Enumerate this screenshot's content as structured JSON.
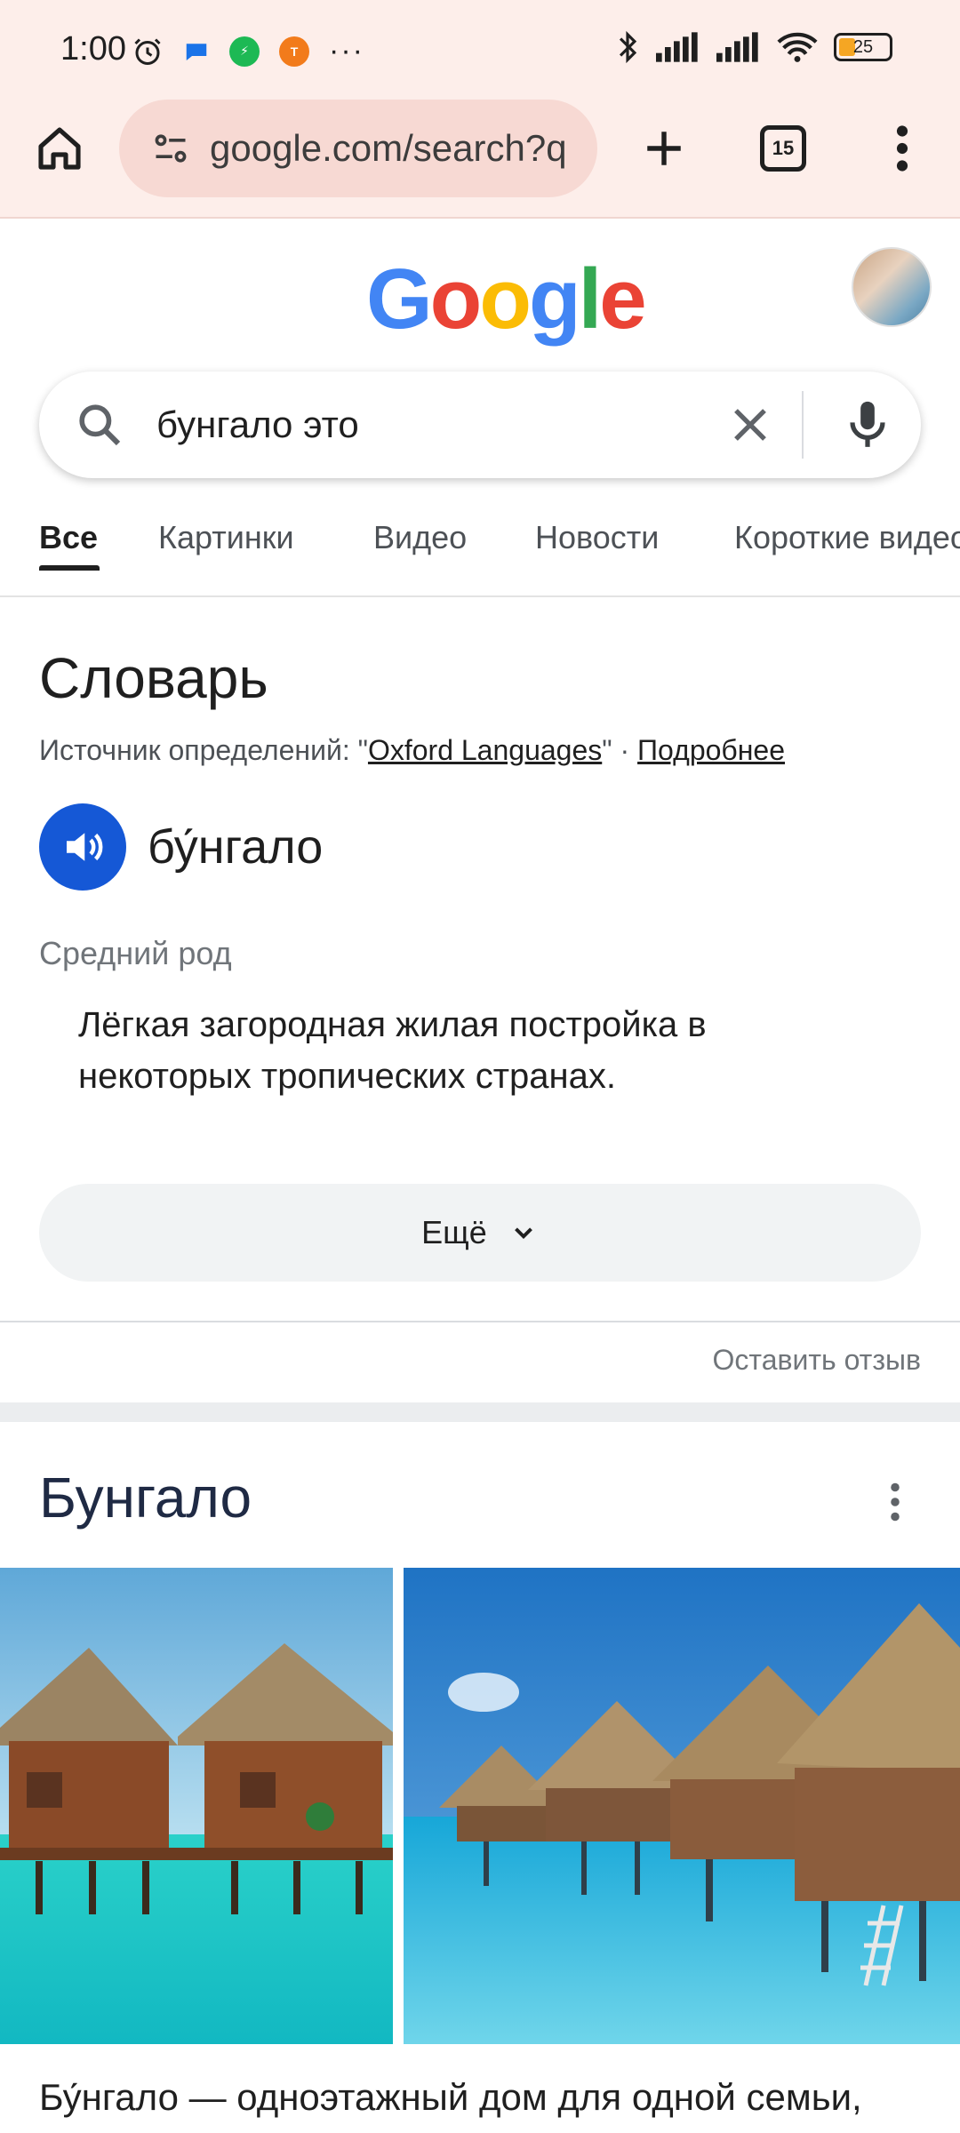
{
  "status_bar": {
    "time": "1:00",
    "battery": "25"
  },
  "browser": {
    "url": "google.com/search?q",
    "tab_count": "15"
  },
  "search": {
    "query": "бунгало это"
  },
  "tabs": [
    {
      "label": "Все",
      "active": true
    },
    {
      "label": "Картинки",
      "active": false
    },
    {
      "label": "Видео",
      "active": false
    },
    {
      "label": "Новости",
      "active": false
    },
    {
      "label": "Короткие видео",
      "active": false
    }
  ],
  "dictionary": {
    "title": "Словарь",
    "source_prefix": "Источник определений: \"",
    "source_name": "Oxford Languages",
    "source_suffix": "\" · ",
    "more_link": "Подробнее",
    "headword": "бу́нгало",
    "part_of_speech": "Средний род",
    "definition": "Лёгкая загородная жилая постройка в некоторых тропических странах.",
    "more_button": "Ещё",
    "feedback": "Оставить отзыв"
  },
  "knowledge_panel": {
    "title": "Бунгало",
    "description": "Бу́нгало — одноэтажный дом для одной семьи,"
  },
  "colors": {
    "chrome_bg": "#fdeeea",
    "omnibox_bg": "#f7d9d3",
    "speaker_blue": "#1558d6",
    "google_blue": "#4285f4",
    "google_red": "#ea4335",
    "google_yellow": "#fbbc05",
    "google_green": "#34a853"
  }
}
